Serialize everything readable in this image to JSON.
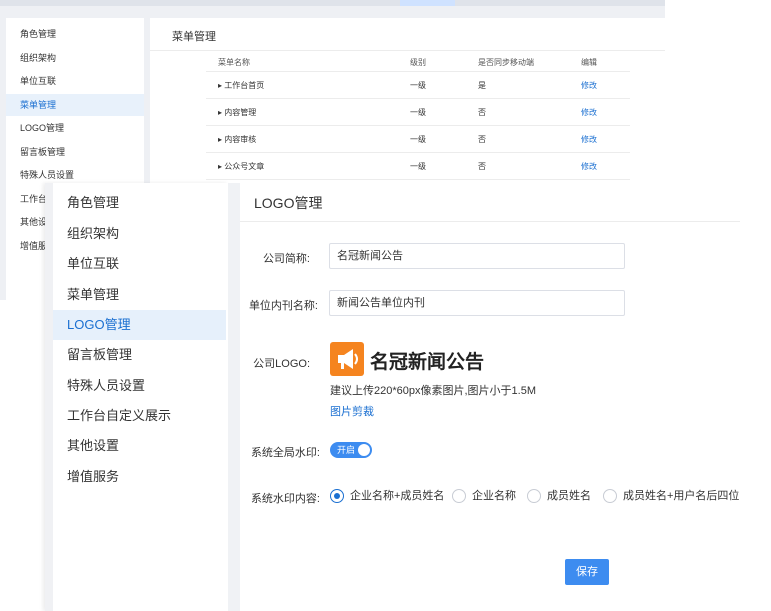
{
  "bg": {
    "sidebar_items": [
      "角色管理",
      "组织架构",
      "单位互联",
      "菜单管理",
      "LOGO管理",
      "留言板管理",
      "特殊人员设置",
      "工作台",
      "其他设",
      "增值服"
    ],
    "title": "菜单管理",
    "table": {
      "headers": [
        "菜单名称",
        "级别",
        "是否同步移动端",
        "编辑"
      ],
      "rows": [
        {
          "name": "▸ 工作台首页",
          "level": "一级",
          "sync": "是",
          "edit": "修改"
        },
        {
          "name": "▸ 内容管理",
          "level": "一级",
          "sync": "否",
          "edit": "修改"
        },
        {
          "name": "▸ 内容审核",
          "level": "一级",
          "sync": "否",
          "edit": "修改"
        },
        {
          "name": "▸ 公众号文章",
          "level": "一级",
          "sync": "否",
          "edit": "修改"
        }
      ]
    }
  },
  "sidebar": {
    "items": [
      "角色管理",
      "组织架构",
      "单位互联",
      "菜单管理",
      "LOGO管理",
      "留言板管理",
      "特殊人员设置",
      "工作台自定义展示",
      "其他设置",
      "增值服务"
    ],
    "active": "LOGO管理"
  },
  "main": {
    "title": "LOGO管理",
    "company_short_label": "公司简称:",
    "company_short_value": "名冠新闻公告",
    "internal_pub_label": "单位内刊名称:",
    "internal_pub_value": "新闻公告单位内刊",
    "logo_label": "公司LOGO:",
    "logo_name": "名冠新闻公告",
    "logo_hint": "建议上传220*60px像素图片,图片小于1.5M",
    "crop_link": "图片剪裁",
    "watermark_label": "系统全局水印:",
    "watermark_switch": "开启",
    "watermark_content_label": "系统水印内容:",
    "radio_options": [
      "企业名称+成员姓名",
      "企业名称",
      "成员姓名",
      "成员姓名+用户名后四位"
    ],
    "save_button": "保存"
  },
  "colors": {
    "accent": "#1a6fd1",
    "button": "#3d8cf0",
    "logo": "#f5841f",
    "active_bg": "#e6f0fb"
  },
  "icons": [
    "megaphone-icon",
    "radio-icon",
    "toggle-icon"
  ]
}
